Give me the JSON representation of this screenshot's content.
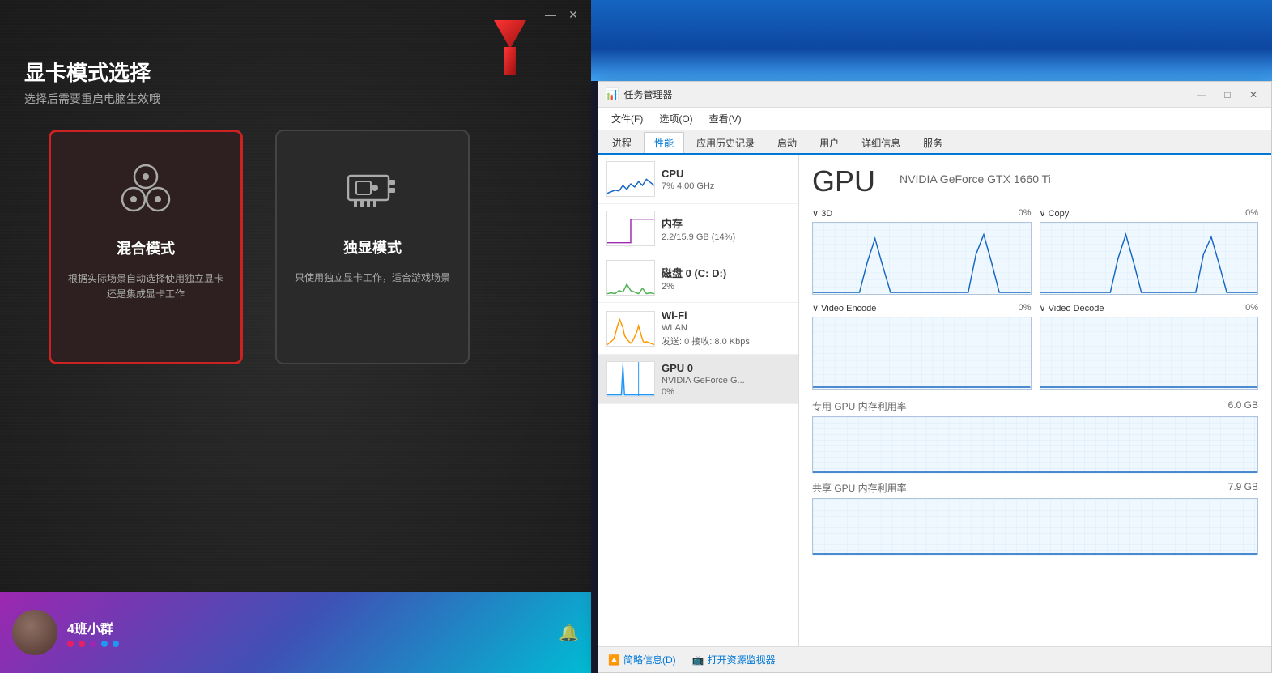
{
  "left_panel": {
    "title": "显卡模式选择",
    "subtitle": "选择后需要重启电脑生效哦",
    "minimize_label": "—",
    "close_label": "✕",
    "cards": [
      {
        "id": "hybrid",
        "title": "混合模式",
        "desc": "根据实际场景自动选择使用独立显卡还是集成显卡工作",
        "active": true
      },
      {
        "id": "discrete",
        "title": "独显模式",
        "desc": "只使用独立显卡工作，适合游戏场景",
        "active": false
      }
    ],
    "bottom_bar": {
      "group_name": "4班小群",
      "dots": [
        "#e91e63",
        "#9c27b0",
        "#2196f3"
      ]
    }
  },
  "task_manager": {
    "title": "任务管理器",
    "menu": [
      "文件(F)",
      "选项(O)",
      "查看(V)"
    ],
    "tabs": [
      "进程",
      "性能",
      "应用历史记录",
      "启动",
      "用户",
      "详细信息",
      "服务"
    ],
    "active_tab": "性能",
    "sidebar_items": [
      {
        "name": "CPU",
        "sub": "7% 4.00 GHz",
        "chart_color": "#1565c0"
      },
      {
        "name": "内存",
        "sub": "2.2/15.9 GB (14%)",
        "chart_color": "#9c27b0"
      },
      {
        "name": "磁盘 0 (C: D:)",
        "sub": "2%",
        "chart_color": "#4caf50"
      },
      {
        "name": "Wi-Fi",
        "sub": "WLAN\n发送: 0 接收: 8.0 Kbps",
        "sub2": "WLAN",
        "sub3": "发送: 0 接收: 8.0 Kbps",
        "chart_color": "#ff9800"
      },
      {
        "name": "GPU 0",
        "sub": "NVIDIA GeForce G...",
        "sub2": "0%",
        "chart_color": "#2196f3",
        "active": true
      }
    ],
    "gpu_detail": {
      "title": "GPU",
      "model": "NVIDIA GeForce GTX 1660 Ti",
      "charts": [
        {
          "label": "3D",
          "pct": "0%",
          "has_spike": true
        },
        {
          "label": "Copy",
          "pct": "0%",
          "has_spike": true
        },
        {
          "label": "Video Encode",
          "pct": "0%",
          "has_spike": false
        },
        {
          "label": "Video Decode",
          "pct": "0%",
          "has_spike": false
        }
      ],
      "dedicated_mem": {
        "label": "专用 GPU 内存利用率",
        "value": "6.0 GB"
      },
      "shared_mem": {
        "label": "共享 GPU 内存利用率",
        "value": "7.9 GB"
      }
    },
    "footer": {
      "summary_label": "简略信息(D)",
      "resource_label": "打开资源监视器"
    }
  }
}
